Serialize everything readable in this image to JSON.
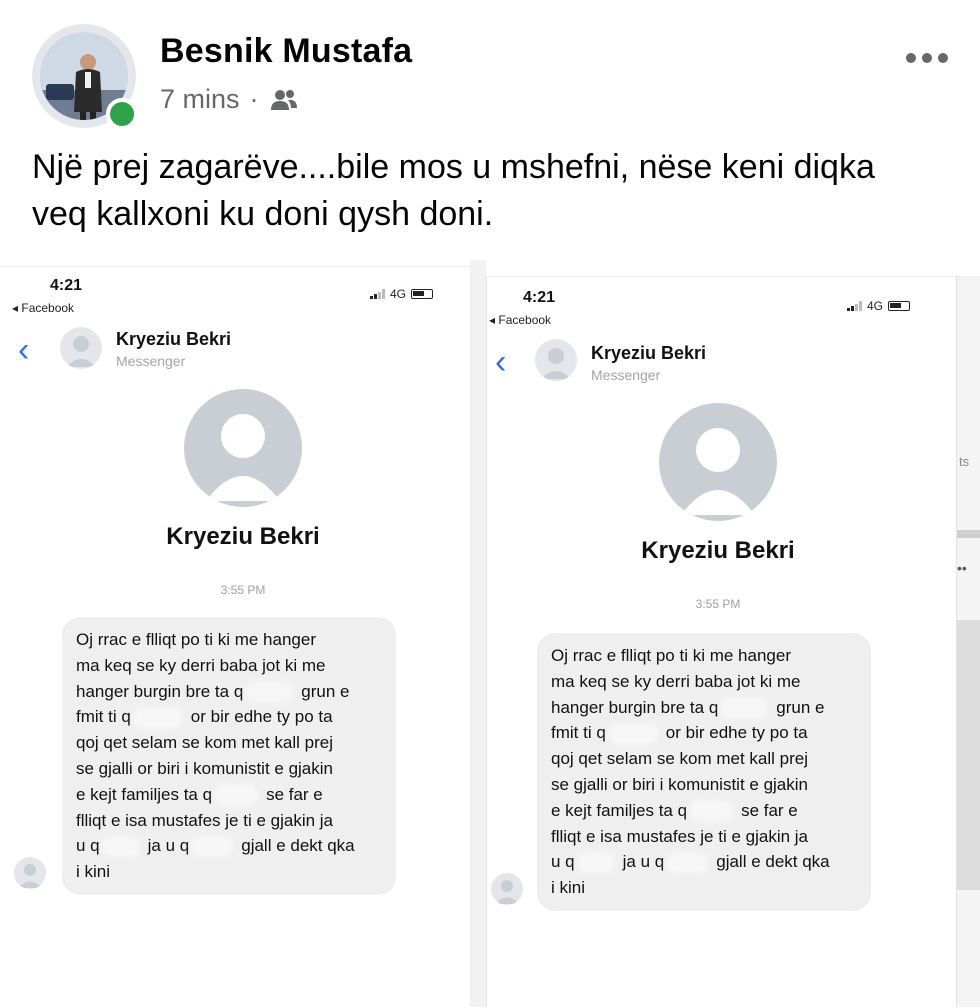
{
  "post": {
    "author": "Besnik Mustafa",
    "time": "7 mins",
    "separator": "·",
    "audience_icon": "friends-icon",
    "more_icon": "more-options-icon",
    "text": "Një prej zagarëve....bile mos u mshefni, nëse keni diqka veq kallxoni ku doni qysh doni."
  },
  "screenshots": [
    {
      "phone_time": "4:21",
      "back_app": "◂ Facebook",
      "network": "4G",
      "contact_name": "Kryeziu Bekri",
      "contact_sub": "Messenger",
      "profile_name": "Kryeziu Bekri",
      "timestamp": "3:55 PM",
      "message_lines": [
        "Oj rrac e flliqt po ti ki me hanger",
        "ma keq se ky derri baba jot ki me",
        "hanger burgin bre ta q",
        "grun e",
        "fmit ti q",
        "or bir edhe ty po ta",
        "qoj qet selam se kom met kall prej",
        "se gjalli or biri i komunistit e gjakin",
        "e kejt familjes ta q",
        "se far e",
        "flliqt e isa mustafes je ti e gjakin ja",
        "u q",
        "ja u q",
        "gjall e dekt qka",
        "i kini"
      ]
    },
    {
      "phone_time": "4:21",
      "back_app": "◂ Facebook",
      "network": "4G",
      "contact_name": "Kryeziu Bekri",
      "contact_sub": "Messenger",
      "profile_name": "Kryeziu Bekri",
      "timestamp": "3:55 PM",
      "message_lines": [
        "Oj rrac e flliqt po ti ki me hanger",
        "ma keq se ky derri baba jot ki me",
        "hanger burgin bre ta q",
        "grun e",
        "fmit ti q",
        "or bir edhe ty po ta",
        "qoj qet selam se kom met kall prej",
        "se gjalli or biri i komunistit e gjakin",
        "e kejt familjes ta q",
        "se far e",
        "flliqt e isa mustafes je ti e gjakin ja",
        "u q",
        "ja u q",
        "gjall e dekt qka",
        "i kini"
      ]
    }
  ],
  "edge_fragments": [
    "ts",
    "••"
  ]
}
